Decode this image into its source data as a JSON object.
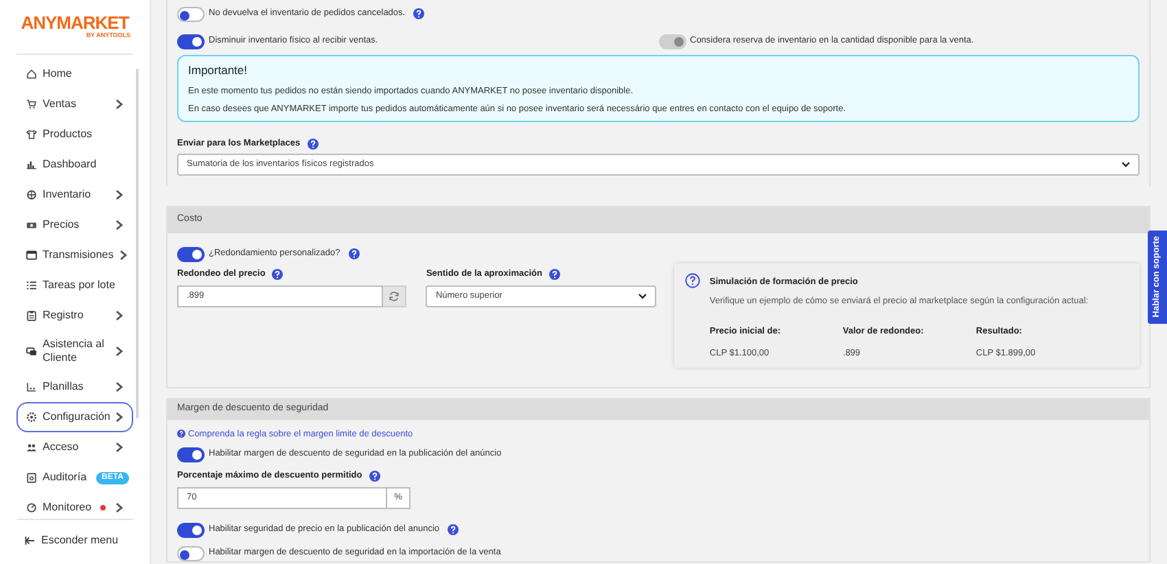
{
  "sidebar": {
    "logo": "ANYMARKET",
    "logo_sub": "BY ANYTOOLS",
    "items": [
      {
        "label": "Home",
        "submenu": false,
        "selected": false
      },
      {
        "label": "Ventas",
        "submenu": true,
        "selected": false
      },
      {
        "label": "Productos",
        "submenu": false,
        "selected": false
      },
      {
        "label": "Dashboard",
        "submenu": false,
        "selected": false
      },
      {
        "label": "Inventario",
        "submenu": true,
        "selected": false
      },
      {
        "label": "Precios",
        "submenu": true,
        "selected": false
      },
      {
        "label": "Transmisiones",
        "submenu": true,
        "selected": false
      },
      {
        "label": "Tareas por lote",
        "submenu": false,
        "selected": false
      },
      {
        "label": "Registro",
        "submenu": true,
        "selected": false
      },
      {
        "label": "Asistencia al Cliente",
        "submenu": true,
        "selected": false
      },
      {
        "label": "Planillas",
        "submenu": true,
        "selected": false
      },
      {
        "label": "Configuración",
        "submenu": true,
        "selected": true
      },
      {
        "label": "Acceso",
        "submenu": true,
        "selected": false
      },
      {
        "label": "Auditoría",
        "badge": "BETA",
        "submenu": false,
        "selected": false
      },
      {
        "label": "Monitoreo",
        "alert": true,
        "submenu": true,
        "selected": false
      }
    ],
    "collapse": "Esconder menu"
  },
  "inventory": {
    "toggles": [
      {
        "label": "No devuelva el inventario de pedidos cancelados.",
        "on": false,
        "help": true
      }
    ],
    "toggle_pair": [
      {
        "label": "Disminuir inventario físico al recibir ventas.",
        "on": true,
        "disabled": false
      },
      {
        "label": "Considera reserva de inventario en la cantidad disponible para la venta.",
        "on": true,
        "disabled": true
      }
    ],
    "notice": {
      "title": "Importante!",
      "lines": [
        "En este momento tus pedidos no están siendo importados cuando ANYMARKET no posee inventario disponible.",
        "En caso desees que ANYMARKET importe tus pedidos automáticamente aún si no posee inventario será necessário que entres en contacto con el equipo de soporte."
      ]
    },
    "send_label": "Enviar para los Marketplaces",
    "send_value": "Sumatoria de los inventarios físicos registrados"
  },
  "costo": {
    "header": "Costo",
    "toggle": {
      "label": "¿Redondamiento personalizado?",
      "on": true
    },
    "rounding_label": "Redondeo del precio",
    "rounding_value": ".899",
    "direction_label": "Sentido de la aproximación",
    "direction_value": "Número superior",
    "simulation": {
      "title": "Simulación de formación de precio",
      "subtitle": "Verifique un ejemplo de cómo se enviará el precio al marketplace según la configuración actual:",
      "columns": [
        {
          "label": "Precio inicial de:",
          "value": "CLP $1.100,00"
        },
        {
          "label": "Valor de redondeo:",
          "value": ".899"
        },
        {
          "label": "Resultado:",
          "value": "CLP $1.899,00"
        }
      ]
    }
  },
  "margen": {
    "header": "Margen de descuento de seguridad",
    "link": "Comprenda la regla sobre el margen limite de descuento",
    "toggle1": {
      "label": "Habilitar margen de descuento de seguridad en la publicación del anúncio",
      "on": true
    },
    "percent_label": "Porcentaje máximo de descuento permitido",
    "percent_value": "70",
    "percent_unit": "%",
    "toggle2": {
      "label": "Habilitar seguridad de precio en la publicación del anuncio",
      "on": true
    },
    "toggle3": {
      "label": "Habilitar margen de descuento de seguridad en la importación de la venta",
      "on": false
    }
  },
  "support_tab": "Hablar con soporte"
}
